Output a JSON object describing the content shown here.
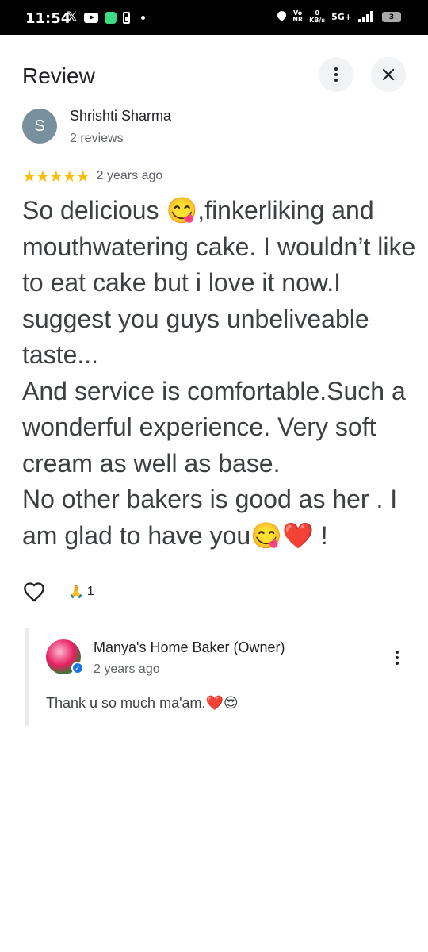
{
  "status_bar": {
    "time": "11:54",
    "x_app": "𝕏",
    "volte": "Vo\nNR",
    "speed_value": "0",
    "speed_unit": "KB/s",
    "network": "5G+",
    "battery": "3"
  },
  "header": {
    "title": "Review"
  },
  "review": {
    "author_initial": "S",
    "author_name": "Shrishti Sharma",
    "author_meta": "2 reviews",
    "rating": 5,
    "stars": "★★★★★",
    "date": "2 years ago",
    "text": "So delicious 😋,finkerliking and mouthwatering cake. I wouldn’t like to eat cake but i love it now.I suggest you guys unbeliveable taste...\nAnd service is comfortable.Such a wonderful experience. Very soft cream as well as base.\nNo other bakers is good as her . I am glad to have you😋❤️ !",
    "reaction_emoji": "🙏",
    "reaction_count": "1"
  },
  "owner_reply": {
    "name": "Manya's Home Baker (Owner)",
    "date": "2 years ago",
    "text": "Thank u so much ma'am.❤️😍"
  },
  "colors": {
    "star": "#fbbc04",
    "verified": "#1a73e8",
    "avatar": "#78909c",
    "button_bg": "#f1f3f4"
  },
  "icons": {
    "more": "more-vert-icon",
    "close": "close-icon",
    "like": "heart-outline-icon",
    "verified": "verified-check-icon"
  }
}
